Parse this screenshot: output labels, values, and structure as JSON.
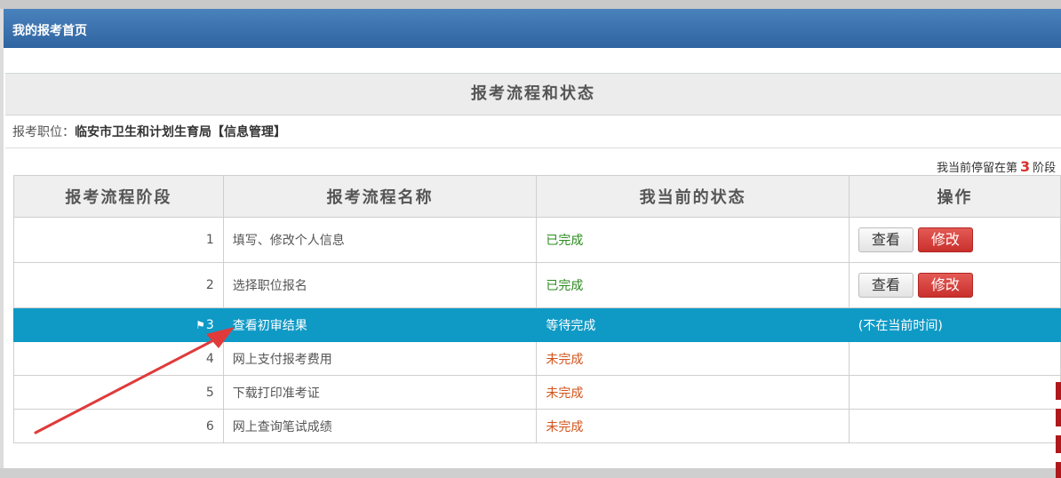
{
  "header": {
    "title": "我的报考首页"
  },
  "section": {
    "title": "报考流程和状态"
  },
  "position": {
    "label": "报考职位：",
    "value": "临安市卫生和计划生育局【信息管理】"
  },
  "stage_note": {
    "prefix": "我当前停留在第",
    "number": "3",
    "suffix": "阶段"
  },
  "table": {
    "headers": [
      "报考流程阶段",
      "报考流程名称",
      "我当前的状态",
      "操作"
    ],
    "rows": [
      {
        "stage": "1",
        "name": "填写、修改个人信息",
        "status": "已完成",
        "action_view": "查看",
        "action_edit": "修改"
      },
      {
        "stage": "2",
        "name": "选择职位报名",
        "status": "已完成",
        "action_view": "查看",
        "action_edit": "修改"
      },
      {
        "stage": "3",
        "name": "查看初审结果",
        "status": "等待完成",
        "action_note": "(不在当前时间)"
      },
      {
        "stage": "4",
        "name": "网上支付报考费用",
        "status": "未完成"
      },
      {
        "stage": "5",
        "name": "下载打印准考证",
        "status": "未完成"
      },
      {
        "stage": "6",
        "name": "网上查询笔试成绩",
        "status": "未完成"
      }
    ]
  },
  "colors": {
    "header_bg": "#2f64a0",
    "current_row_bg": "#0f9ac6",
    "done": "#2b8a1e",
    "pending": "#d2531b",
    "edit_button": "#c9302c",
    "arrow": "#e03a3a"
  },
  "icons": {
    "current_stage": "flag-icon",
    "annotation": "red-arrow-annotation"
  }
}
